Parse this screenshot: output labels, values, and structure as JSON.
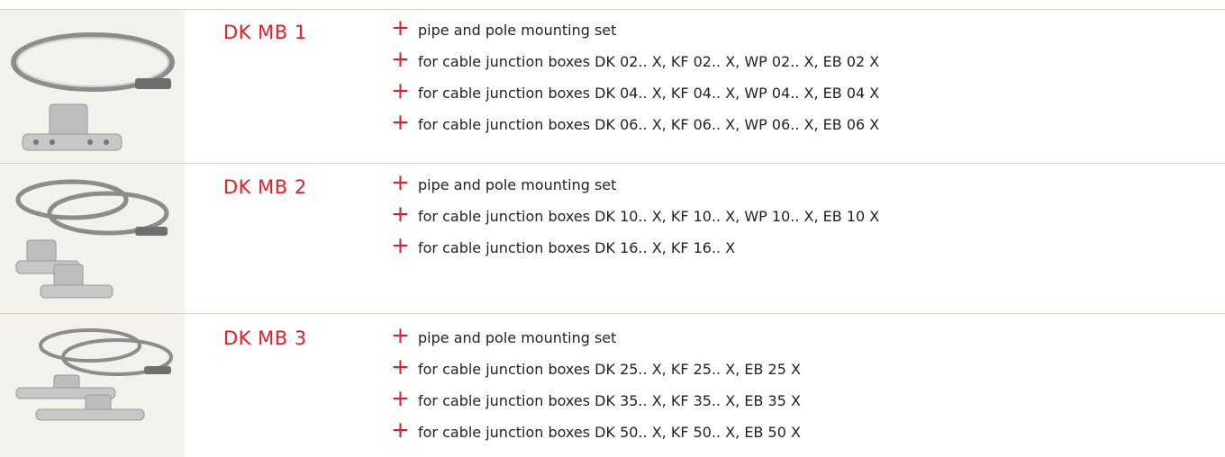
{
  "products": [
    {
      "model": "DK MB 1",
      "image_icon": "pipe-clamp-mounting-set-single",
      "features": [
        "pipe and pole mounting set",
        "for cable junction boxes DK 02.. X, KF 02.. X, WP 02.. X, EB 02 X",
        "for cable junction boxes DK 04.. X, KF 04.. X, WP 04.. X, EB 04 X",
        "for cable junction boxes DK 06.. X, KF 06.. X, WP 06.. X, EB 06 X"
      ]
    },
    {
      "model": "DK MB 2",
      "image_icon": "pipe-clamp-mounting-set-double",
      "features": [
        "pipe and pole mounting set",
        "for cable junction boxes DK 10.. X, KF 10.. X, WP 10.. X, EB 10 X",
        "for cable junction boxes DK 16.. X, KF 16.. X"
      ]
    },
    {
      "model": "DK MB 3",
      "image_icon": "pipe-clamp-mounting-set-large",
      "features": [
        "pipe and pole mounting set",
        "for cable junction boxes DK 25.. X, KF 25.. X, EB 25 X",
        "for cable junction boxes DK 35.. X, KF 35.. X, EB 35 X",
        "for cable junction boxes DK 50.. X, KF 50.. X, EB 50 X"
      ]
    }
  ],
  "bullet_symbol": "+",
  "colors": {
    "accent": "#e21f26",
    "divider": "#d9d3c4",
    "text": "#222222",
    "thumb_bg": "#f3f1ec"
  }
}
